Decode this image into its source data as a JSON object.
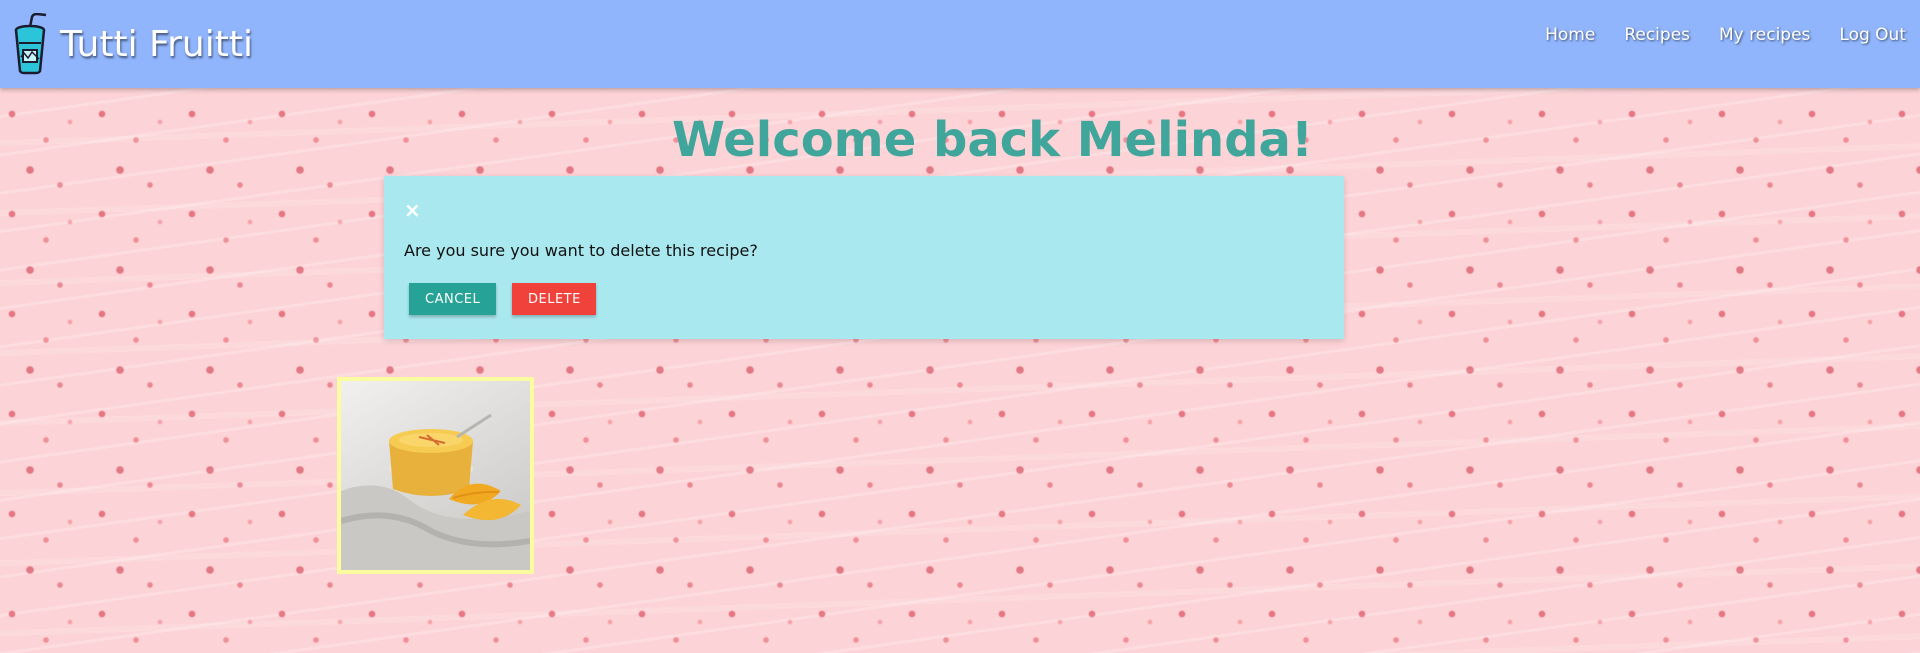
{
  "navbar": {
    "brand_name": "Tutti Fruitti",
    "brand_icon": "smoothie-cup-icon",
    "links": [
      {
        "label": "Home"
      },
      {
        "label": "Recipes"
      },
      {
        "label": "My recipes"
      },
      {
        "label": "Log Out"
      }
    ]
  },
  "main": {
    "welcome_heading": "Welcome back Melinda!"
  },
  "modal": {
    "close_symbol": "×",
    "message": "Are you sure you want to delete this recipe?",
    "cancel_label": "CANCEL",
    "delete_label": "DELETE"
  },
  "recipes": [
    {
      "image_subject": "mango-pudding-jar"
    }
  ],
  "colors": {
    "navbar_bg": "#90b5fd",
    "heading": "#40a59b",
    "modal_bg": "#aae8ef",
    "cancel_button": "#26a396",
    "delete_button": "#f0413a",
    "card_border": "#fbfba0"
  }
}
